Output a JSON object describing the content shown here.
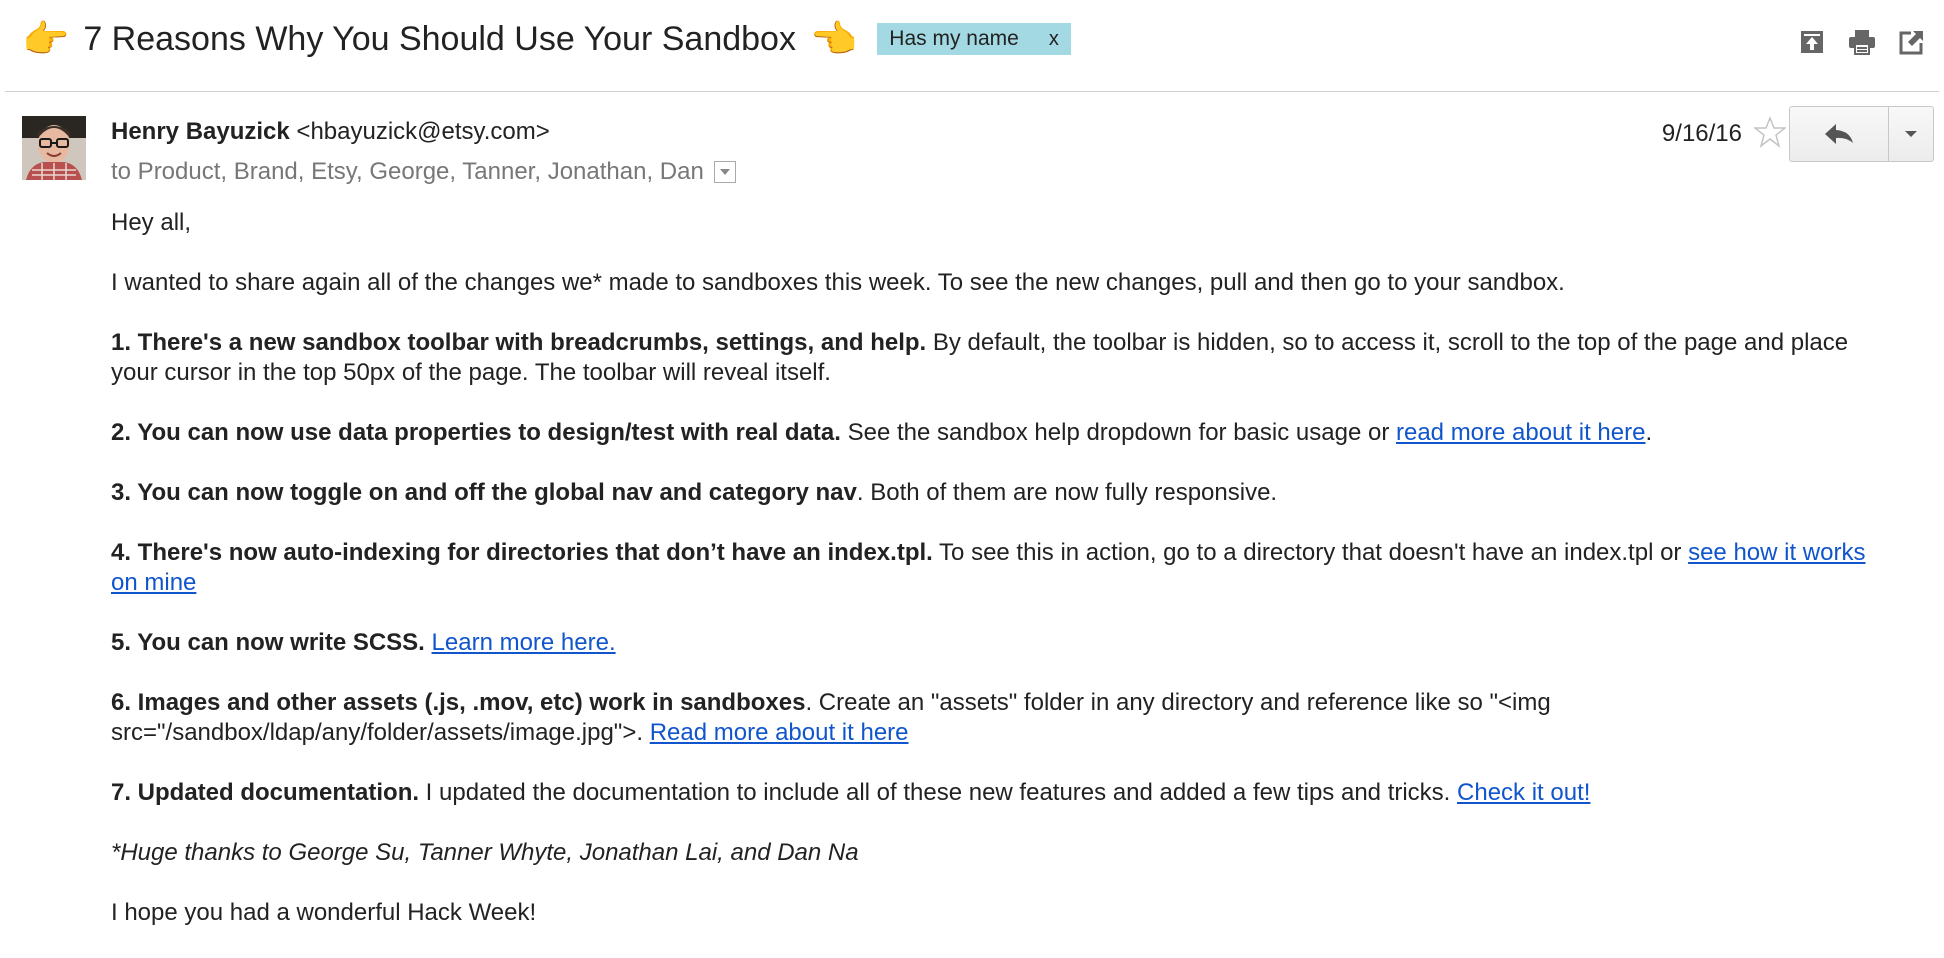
{
  "subject": {
    "emoji_left": "👉",
    "title": "7 Reasons Why You Should Use Your Sandbox",
    "emoji_right": "👈",
    "label": "Has my name",
    "label_remove": "x"
  },
  "header_icons": [
    "move-to-inbox-icon",
    "print-icon",
    "new-window-icon"
  ],
  "message": {
    "sender_name": "Henry Bayuzick",
    "sender_email": "<hbayuzick@etsy.com>",
    "to": "to Product, Brand, Etsy, George, Tanner, Jonathan, Dan",
    "date": "9/16/16"
  },
  "colors": {
    "label_bg": "#a3d9e3",
    "link": "#1155cc",
    "emoji": "#e8a317"
  },
  "body": {
    "greeting": "Hey all,",
    "intro": "I wanted to share again all of the changes we* made to sandboxes this week. To see the new changes, pull and then go to your sandbox.",
    "item1_bold": "1. There's a new sandbox toolbar with breadcrumbs, settings, and help.",
    "item1_text": " By default, the toolbar is hidden, so to access it, scroll to the top of the page and place your cursor in the top 50px of the page. The toolbar will reveal itself.",
    "item2_bold": "2. You can now use data properties to design/test with real data.",
    "item2_text": " See the sandbox help dropdown for basic usage or ",
    "item2_link": "read more about it here",
    "item2_end": ".",
    "item3_bold": "3. You can now toggle on and off the global nav and category nav",
    "item3_text": ". Both of them are now fully responsive.",
    "item4_bold": "4. There's now auto-indexing for directories that don’t have an index.tpl.",
    "item4_text": " To see this in action, go to a directory that doesn't have an index.tpl or ",
    "item4_link": "see how it works on mine",
    "item5_bold": "5. You can now write SCSS.",
    "item5_link": "Learn more here.",
    "item6_bold": "6. Images and other assets (.js, .mov, etc) work in sandboxes",
    "item6_text": ". Create an \"assets\" folder in any directory and reference like so \"<img src=\"/sandbox/ldap/any/folder/assets/image.jpg\">. ",
    "item6_link": "Read more about it here",
    "item7_bold": "7. Updated documentation.",
    "item7_text": " I updated the documentation to include all of these new features and added a few tips and tricks. ",
    "item7_link": "Check it out!",
    "thanks": "*Huge thanks to George Su, Tanner Whyte, Jonathan Lai, and Dan Na",
    "closing": "I hope you had a wonderful Hack Week!"
  }
}
